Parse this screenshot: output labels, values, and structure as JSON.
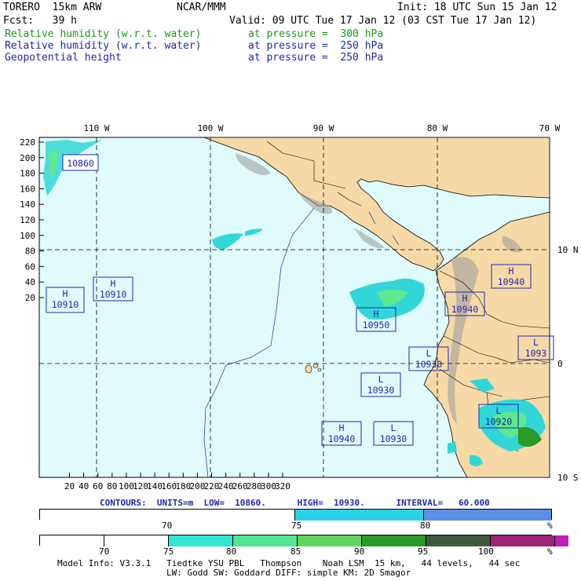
{
  "header": {
    "model": "TORERO  15km ARW",
    "org": "NCAR/MMM",
    "init": "Init: 18 UTC Sun 15 Jan 12",
    "fcst": "Fcst:   39 h",
    "valid": "Valid: 09 UTC Tue 17 Jan 12 (03 CST Tue 17 Jan 12)",
    "fields": [
      {
        "name": "Relative humidity (w.r.t. water)",
        "level": "at pressure =  300 hPa",
        "color": "#1a9a1a"
      },
      {
        "name": "Relative humidity (w.r.t. water)",
        "level": "at pressure =  250 hPa",
        "color": "#1e2aa8"
      },
      {
        "name": "Geopotential height",
        "level": "at pressure =  250 hPa",
        "color": "#1e2aa8"
      }
    ]
  },
  "map": {
    "top_lon_labels": [
      "110 W",
      "100 W",
      "90 W",
      "80 W",
      "70 W"
    ],
    "right_lat_labels": [
      "10 N",
      "0",
      "10 S"
    ],
    "left_ticks": [
      "220",
      "200",
      "180",
      "160",
      "140",
      "120",
      "100",
      "80",
      "60",
      "40",
      "20"
    ],
    "bottom_ticks": [
      "20",
      "40",
      "60",
      "80",
      "100",
      "120",
      "140",
      "160",
      "180",
      "200",
      "220",
      "240",
      "260",
      "280",
      "300",
      "320"
    ],
    "centers": [
      {
        "type": "",
        "value": "10860"
      },
      {
        "type": "H",
        "value": "10910"
      },
      {
        "type": "H",
        "value": "10910"
      },
      {
        "type": "H",
        "value": "10940"
      },
      {
        "type": "H",
        "value": "10950"
      },
      {
        "type": "H",
        "value": "10940"
      },
      {
        "type": "L",
        "value": "10930"
      },
      {
        "type": "L",
        "value": "10930"
      },
      {
        "type": "L",
        "value": "1093"
      },
      {
        "type": "L",
        "value": "10920"
      },
      {
        "type": "H",
        "value": "10940"
      },
      {
        "type": "L",
        "value": "10930"
      }
    ],
    "colors": {
      "ocean": "#e0fbfb",
      "land": "#f7d9a8",
      "rh300": "#33d6d6",
      "rh250": "#5ee88f"
    }
  },
  "contour_info": "CONTOURS:  UNITS=m  LOW=  10860.      HIGH=  10930.      INTERVAL=   60.000",
  "bar1": {
    "segments": [
      {
        "color": "#ffffff"
      },
      {
        "color": "#2bd2e6"
      },
      {
        "color": "#5b8fe6"
      }
    ],
    "labels": [
      "70",
      "75",
      "80",
      "%"
    ]
  },
  "bar2": {
    "segments": [
      {
        "color": "#ffffff"
      },
      {
        "color": "#ffffff"
      },
      {
        "color": "#2ee6d2"
      },
      {
        "color": "#53e692"
      },
      {
        "color": "#5ed65e"
      },
      {
        "color": "#2a9a2a"
      },
      {
        "color": "#3e5a3e"
      },
      {
        "color": "#a0227a"
      },
      {
        "color": "#c01eba"
      }
    ],
    "labels": [
      "70",
      "75",
      "80",
      "85",
      "90",
      "95",
      "100",
      "%"
    ]
  },
  "footer": {
    "line1": "Model Info: V3.3.1   Tiedtke YSU PBL   Thompson    Noah LSM  15 km,   44 levels,   44 sec",
    "line2": "LW: Godd SW: Goddard DIFF: simple KM: 2D Smagor"
  }
}
